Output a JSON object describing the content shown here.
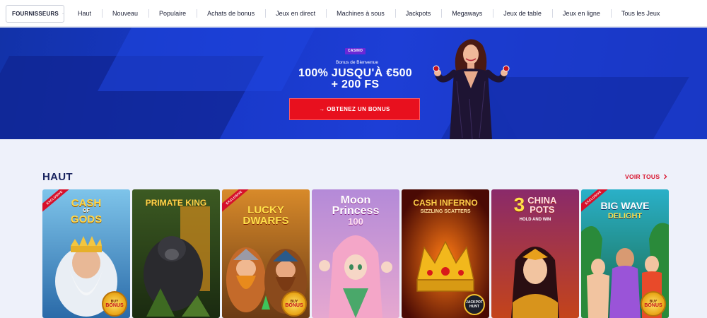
{
  "nav": {
    "providers_label": "FOURNISSEURS",
    "items": [
      "Haut",
      "Nouveau",
      "Populaire",
      "Achats de bonus",
      "Jeux en direct",
      "Machines à sous",
      "Jackpots",
      "Megaways",
      "Jeux de table",
      "Jeux en ligne",
      "Tous les Jeux"
    ]
  },
  "hero": {
    "badge": "CASINO",
    "welcome": "Bonus de Bienvenue",
    "headline_line1": "100% JUSQU'À €500",
    "headline_line2": "+ 200 FS",
    "cta_label": "→ OBTENEZ UN BONUS"
  },
  "section": {
    "title": "HAUT",
    "see_all": "VOIR TOUS",
    "see_all_icon": "chevron-right-icon"
  },
  "games": [
    {
      "title": "CASH OF GODS",
      "title_line1": "CASH",
      "title_small": "OF",
      "title_line2": "GODS",
      "exclusive": "EXCLUSIVE",
      "buy_bonus_top": "BUY",
      "buy_bonus_bottom": "BONUS"
    },
    {
      "title": "PRIMATE KING"
    },
    {
      "title": "LUCKY DWARFS",
      "title_line1": "LUCKY",
      "title_line2": "DWARFS",
      "exclusive": "EXCLUSIVE",
      "buy_bonus_top": "BUY",
      "buy_bonus_bottom": "BONUS"
    },
    {
      "title": "Moon Princess 100",
      "title_line1": "Moon",
      "title_line2": "Princess",
      "title_line3": "100"
    },
    {
      "title": "CASH INFERNO",
      "subtitle": "SIZZLING SCATTERS",
      "badge_line1": "JACKPOT",
      "badge_line2": "HUNT"
    },
    {
      "title": "3 CHINA POTS",
      "title_number": "3",
      "title_line1": "CHINA",
      "title_line2": "POTS",
      "subtitle": "HOLD AND WIN"
    },
    {
      "title": "BIG WAVE DELIGHT",
      "title_line1": "BIG WAVE",
      "title_line2": "DELIGHT",
      "exclusive": "EXCLUSIVE",
      "buy_bonus_top": "BUY",
      "buy_bonus_bottom": "BONUS"
    }
  ],
  "colors": {
    "nav_bg": "#ffffff",
    "hero_blue": "#1d3ed6",
    "cta_red": "#e8101e",
    "section_title": "#1a2560",
    "see_all_red": "#d8122b",
    "page_bg": "#eef1fa"
  }
}
